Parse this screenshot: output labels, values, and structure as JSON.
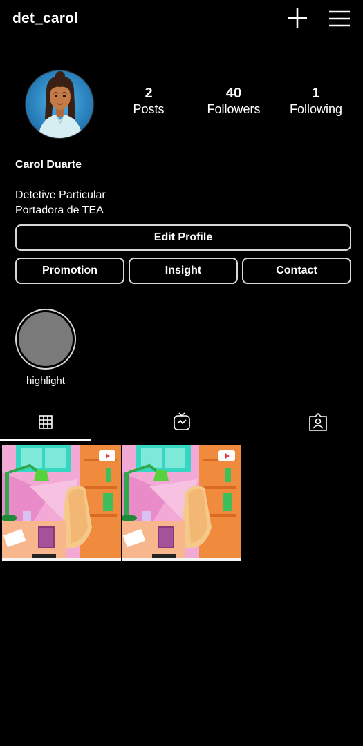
{
  "header": {
    "username": "det_carol",
    "new_post_icon": "plus-icon",
    "menu_icon": "hamburger-menu-icon"
  },
  "profile": {
    "avatar_icon": "profile-avatar",
    "display_name": "Carol Duarte",
    "bio_lines": [
      "Detetive Particular",
      "Portadora de TEA"
    ]
  },
  "stats": [
    {
      "value": "2",
      "label": "Posts"
    },
    {
      "value": "40",
      "label": "Followers"
    },
    {
      "value": "1",
      "label": "Following"
    }
  ],
  "buttons": {
    "edit_profile": "Edit Profile",
    "promotion": "Promotion",
    "insight": "Insight",
    "contact": "Contact"
  },
  "highlights": [
    {
      "label": "highlight"
    }
  ],
  "tabs": [
    {
      "icon": "grid-icon",
      "active": true
    },
    {
      "icon": "igtv-icon",
      "active": false
    },
    {
      "icon": "tagged-person-icon",
      "active": false
    }
  ],
  "posts": [
    {
      "image": "office-illustration"
    },
    {
      "image": "office-illustration"
    }
  ],
  "colors": {
    "background": "#000000",
    "text": "#ffffff",
    "button_border": "#d8d8d8",
    "highlight_fill": "#7a7a7a"
  }
}
